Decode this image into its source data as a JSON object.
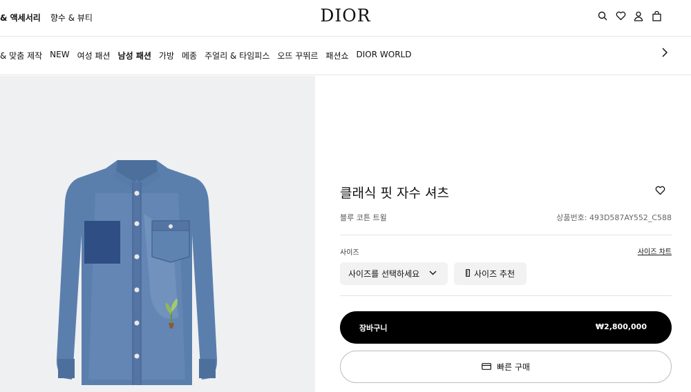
{
  "header": {
    "links": [
      "& 액세서리",
      "향수 & 뷰티"
    ],
    "logo": "DIOR",
    "icons": [
      "search-icon",
      "heart-icon",
      "user-icon",
      "bag-icon"
    ]
  },
  "nav": {
    "items": [
      "& 맞춤 제작",
      "NEW",
      "여성 패션",
      "남성 패션",
      "가방",
      "메종",
      "주얼리 & 타임피스",
      "오뜨 꾸뛰르",
      "패션쇼",
      "DIOR WORLD"
    ],
    "active": "남성 패션",
    "next_icon": "chevron-right-icon"
  },
  "product": {
    "title": "클래식 핏 자수 셔츠",
    "subtitle": "블루 코튼 트윌",
    "code": "상품번호: 493D587AY552_C588",
    "size_label": "사이즈",
    "size_chart": "사이즈 차트",
    "size_select": "사이즈를 선택하세요",
    "size_recommend": "사이즈 추천",
    "cart_label": "장바구니",
    "price": "₩2,800,000",
    "quick_buy": "빠른 구매"
  },
  "colors": {
    "image_bg": "#eff0f2",
    "denim": "#5b7fad",
    "cart_bg": "#000000"
  }
}
